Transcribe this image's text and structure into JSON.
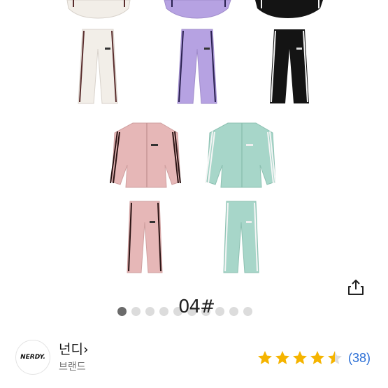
{
  "gallery": {
    "products": [
      {
        "color": "cream",
        "jacket": "#f2eee8",
        "pants": "#f2eee8",
        "stripe": "#5a2d2d"
      },
      {
        "color": "lavender",
        "jacket": "#b6a2e2",
        "pants": "#b6a2e2",
        "stripe": "#2a2150"
      },
      {
        "color": "black",
        "jacket": "#141414",
        "pants": "#141414",
        "stripe": "#f5f5f5"
      },
      {
        "color": "pink",
        "jacket": "#e6b7b7",
        "pants": "#e6b7b7",
        "stripe": "#2b1414"
      },
      {
        "color": "mint",
        "jacket": "#a7d6c9",
        "pants": "#a7d6c9",
        "stripe": "#f5f5f5"
      }
    ],
    "overlay_text": "04#",
    "share_icon": "share-icon",
    "dots_total": 10,
    "dots_active_index": 0
  },
  "brand": {
    "logo_text": "NERDY.",
    "name": "넌디",
    "chevron": "›",
    "subtitle": "브랜드",
    "rating": 4.5,
    "rating_count": "(38)",
    "star_color": "#f5b400"
  }
}
